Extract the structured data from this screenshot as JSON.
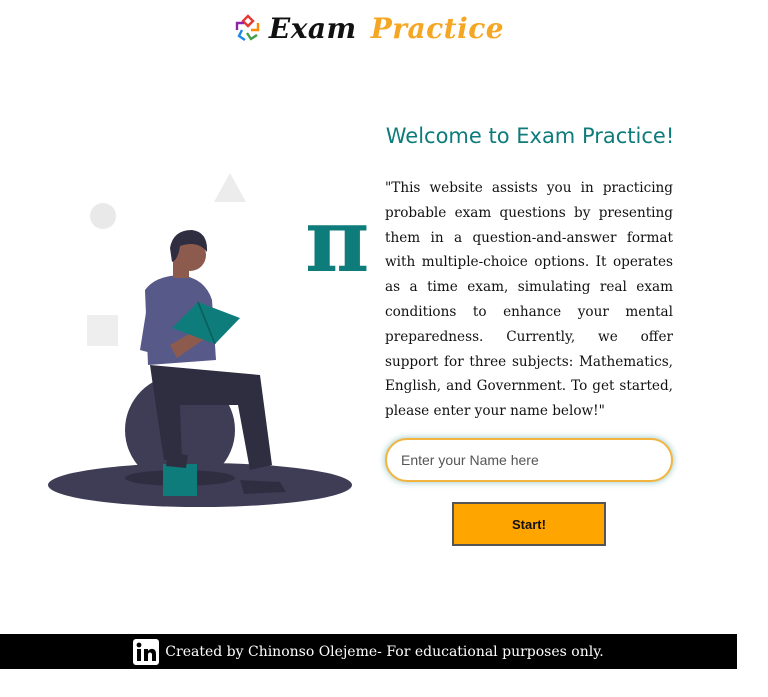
{
  "header": {
    "brand_word_1": "Exam",
    "brand_word_2": "Practice",
    "logo_icon": "colorful-knot-logo-icon",
    "brand_colors": {
      "word_1": "#111111",
      "word_2": "#F5A623"
    }
  },
  "main": {
    "title": "Welcome to Exam Practice!",
    "intro": "\"This website assists you in practicing probable exam questions by presenting them in a question-and-answer format with multiple-choice options. It operates as a time exam, simulating real exam conditions to enhance your mental preparedness. Currently, we offer support for three subjects: Mathematics, English, and Government. To get started, please enter your name below!\"",
    "name_input": {
      "value": "",
      "placeholder": "Enter your Name here"
    },
    "start_button_label": "Start!"
  },
  "illustration": {
    "pi_symbol": "π",
    "icon_names": [
      "person-reading-icon",
      "pi-symbol-icon",
      "triangle-shape",
      "circle-shape",
      "square-shape"
    ]
  },
  "footer": {
    "text": "Created by Chinonso Olejeme- For educational purposes only.",
    "icon": "linkedin-icon"
  },
  "colors": {
    "accent_teal": "#0e7c7b",
    "accent_orange": "#FFA500",
    "footer_bg": "#000000"
  }
}
